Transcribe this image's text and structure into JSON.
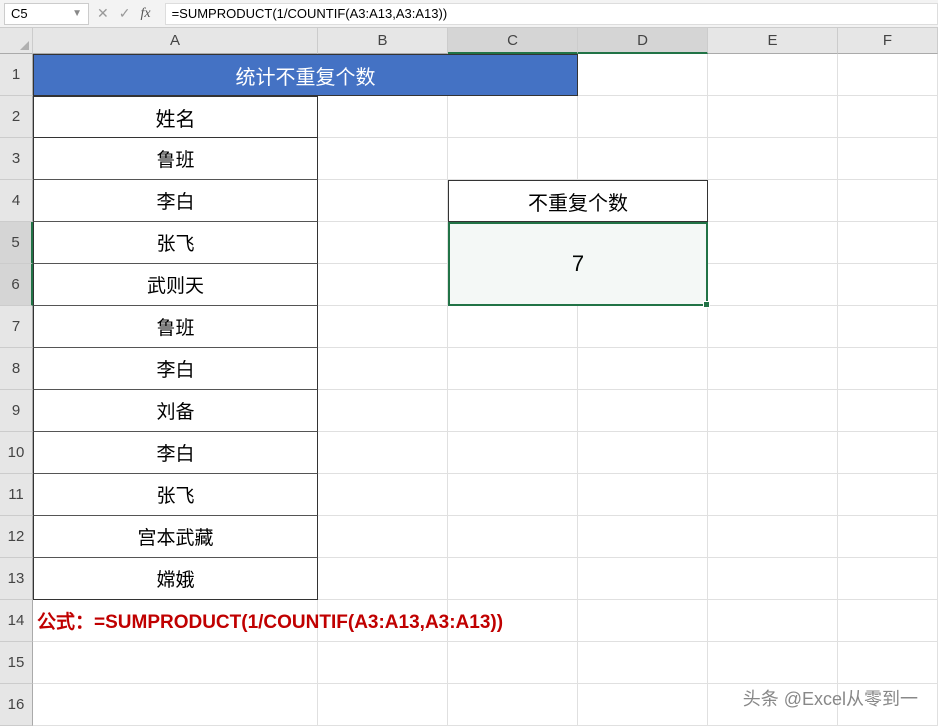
{
  "name_box": "C5",
  "formula_bar": "=SUMPRODUCT(1/COUNTIF(A3:A13,A3:A13))",
  "columns": [
    "A",
    "B",
    "C",
    "D",
    "E",
    "F"
  ],
  "rows": [
    "1",
    "2",
    "3",
    "4",
    "5",
    "6",
    "7",
    "8",
    "9",
    "10",
    "11",
    "12",
    "13",
    "14",
    "15",
    "16"
  ],
  "title_merged": "统计不重复个数",
  "col_a_header": "姓名",
  "col_a_data": [
    "鲁班",
    "李白",
    "张飞",
    "武则天",
    "鲁班",
    "李白",
    "刘备",
    "李白",
    "张飞",
    "宫本武藏",
    "嫦娥"
  ],
  "result_header": "不重复个数",
  "result_value": "7",
  "formula_display": "公式：=SUMPRODUCT(1/COUNTIF(A3:A13,A3:A13))",
  "watermark": "头条 @Excel从零到一",
  "chart_data": {
    "type": "table",
    "title": "统计不重复个数",
    "columns": [
      "姓名"
    ],
    "rows": [
      [
        "鲁班"
      ],
      [
        "李白"
      ],
      [
        "张飞"
      ],
      [
        "武则天"
      ],
      [
        "鲁班"
      ],
      [
        "李白"
      ],
      [
        "刘备"
      ],
      [
        "李白"
      ],
      [
        "张飞"
      ],
      [
        "宫本武藏"
      ],
      [
        "嫦娥"
      ]
    ],
    "computed": {
      "label": "不重复个数",
      "value": 7,
      "formula": "=SUMPRODUCT(1/COUNTIF(A3:A13,A3:A13))"
    }
  }
}
